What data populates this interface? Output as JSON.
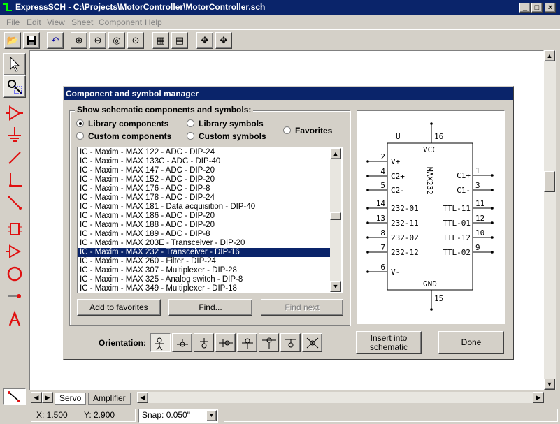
{
  "window": {
    "title": "ExpressSCH - C:\\Projects\\MotorController\\MotorController.sch",
    "min_label": "_",
    "max_label": "□",
    "close_label": "×"
  },
  "menu": [
    "File",
    "Edit",
    "View",
    "Sheet",
    "Component",
    "Help"
  ],
  "toolbar_icons": [
    "open-icon",
    "save-icon",
    "undo-icon",
    "zoom-in-icon",
    "zoom-out-icon",
    "zoom-fit-icon",
    "zoom-page-icon",
    "properties-icon",
    "component-manager-icon",
    "move-icon",
    "drag-icon"
  ],
  "leftbar_icons": [
    "select-arrow-icon",
    "component-search-icon",
    "component-icon",
    "ground-icon",
    "wire-icon",
    "bus-icon",
    "diagonal-wire-icon",
    "rectangle-icon",
    "symbol-icon",
    "circle-icon",
    "pin-icon",
    "text-icon"
  ],
  "dialog": {
    "title": "Component and symbol manager",
    "group_label": "Show schematic components and symbols:",
    "radios": {
      "library_components": "Library components",
      "library_symbols": "Library symbols",
      "custom_components": "Custom components",
      "custom_symbols": "Custom symbols",
      "favorites": "Favorites",
      "selected": "library_components"
    },
    "list_items": [
      "IC - Maxim - MAX 122 - ADC - DIP-24",
      "IC - Maxim - MAX 133C - ADC - DIP-40",
      "IC - Maxim - MAX 147 - ADC - DIP-20",
      "IC - Maxim - MAX 152 - ADC - DIP-20",
      "IC - Maxim - MAX 176 - ADC - DIP-8",
      "IC - Maxim - MAX 178 - ADC - DIP-24",
      "IC - Maxim - MAX 181 - Data acquisition - DIP-40",
      "IC - Maxim - MAX 186 - ADC - DIP-20",
      "IC - Maxim - MAX 188 - ADC - DIP-20",
      "IC - Maxim - MAX 189 - ADC - DIP-8",
      "IC - Maxim - MAX 203E - Transceiver - DIP-20",
      "IC - Maxim - MAX 232 - Transceiver - DIP-16",
      "IC - Maxim - MAX 260 - Filter - DIP-24",
      "IC - Maxim - MAX 307 - Multiplexer - DIP-28",
      "IC - Maxim - MAX 325 - Analog switch - DIP-8",
      "IC - Maxim - MAX 349 - Multiplexer - DIP-18"
    ],
    "selected_index": 11,
    "buttons": {
      "add_favorites": "Add to favorites",
      "find": "Find...",
      "find_next": "Find next",
      "insert": "Insert into\nschematic",
      "done": "Done"
    },
    "orientation_label": "Orientation:",
    "orientation_icons": [
      "orient-0-icon",
      "orient-90-icon",
      "orient-180-icon",
      "orient-270-icon",
      "mirror-0-icon",
      "mirror-90-icon",
      "mirror-180-icon",
      "mirror-270-icon"
    ],
    "preview": {
      "ref": "U",
      "chip_name": "MAX232",
      "top_pin": "16",
      "top_label": "VCC",
      "bottom_pin": "15",
      "bottom_label": "GND",
      "left_pins": [
        {
          "num": "2",
          "label": "V+"
        },
        {
          "num": "4",
          "label": "C2+"
        },
        {
          "num": "5",
          "label": "C2-"
        },
        {
          "num": "14",
          "label": "232-01"
        },
        {
          "num": "13",
          "label": "232-11"
        },
        {
          "num": "8",
          "label": "232-02"
        },
        {
          "num": "7",
          "label": "232-12"
        },
        {
          "num": "6",
          "label": "V-"
        }
      ],
      "right_pins": [
        {
          "num": "1",
          "label": "C1+"
        },
        {
          "num": "3",
          "label": "C1-"
        },
        {
          "num": "11",
          "label": "TTL-11"
        },
        {
          "num": "12",
          "label": "TTL-01"
        },
        {
          "num": "10",
          "label": "TTL-12"
        },
        {
          "num": "9",
          "label": "TTL-02"
        }
      ]
    }
  },
  "tabs": [
    "Servo",
    "Amplifier"
  ],
  "status": {
    "x": "X: 1.500",
    "y": "Y: 2.900",
    "snap": "Snap:  0.050\""
  }
}
